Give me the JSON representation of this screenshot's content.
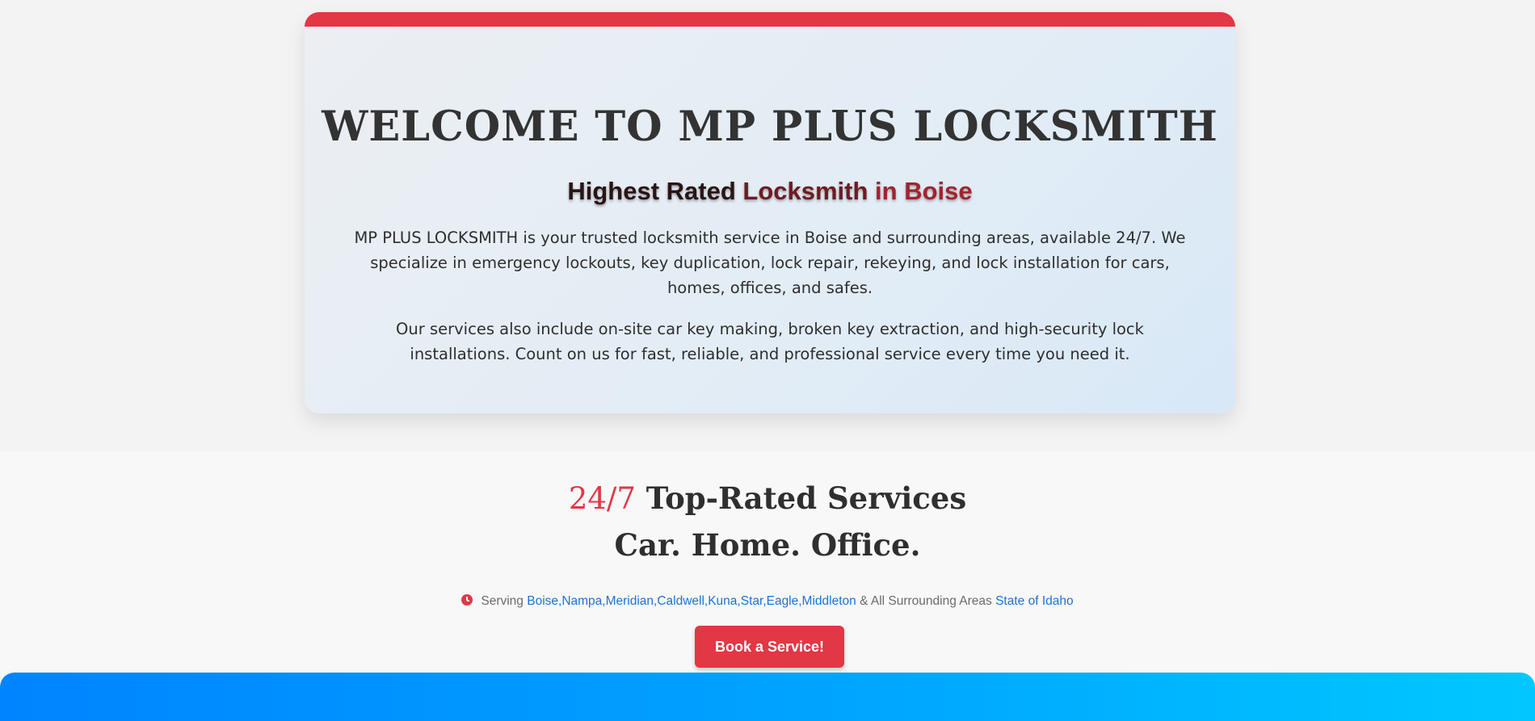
{
  "hero": {
    "title": "WELCOME TO MP PLUS LOCKSMITH",
    "subtitle_part1": "Highest Rated ",
    "subtitle_part2": "Locksmith ",
    "subtitle_part3": "in Boise",
    "paragraph1": "MP PLUS LOCKSMITH is your trusted locksmith service in Boise and surrounding areas, available 24/7. We specialize in emergency lockouts, key duplication, lock repair, rekeying, and lock installation for cars, homes, offices, and safes.",
    "paragraph2": "Our services also include on-site car key making, broken key extraction, and high-security lock installations. Count on us for fast, reliable, and professional service every time you need it."
  },
  "services": {
    "heading_accent": "24/7",
    "heading_rest": " Top-Rated Services",
    "tagline": "Car. Home. Office.",
    "serving_prefix": "Serving ",
    "cities": "Boise,Nampa,Meridian,Caldwell,Kuna,Star,Eagle,Middleton",
    "serving_suffix": " & All Surrounding Areas ",
    "state": "State of Idaho",
    "clock_icon": "clock-icon",
    "book_button": "Book a Service!"
  },
  "colors": {
    "accent_red": "#e23744",
    "link_blue": "#1a73d9",
    "band_blue": "#0084ff"
  }
}
